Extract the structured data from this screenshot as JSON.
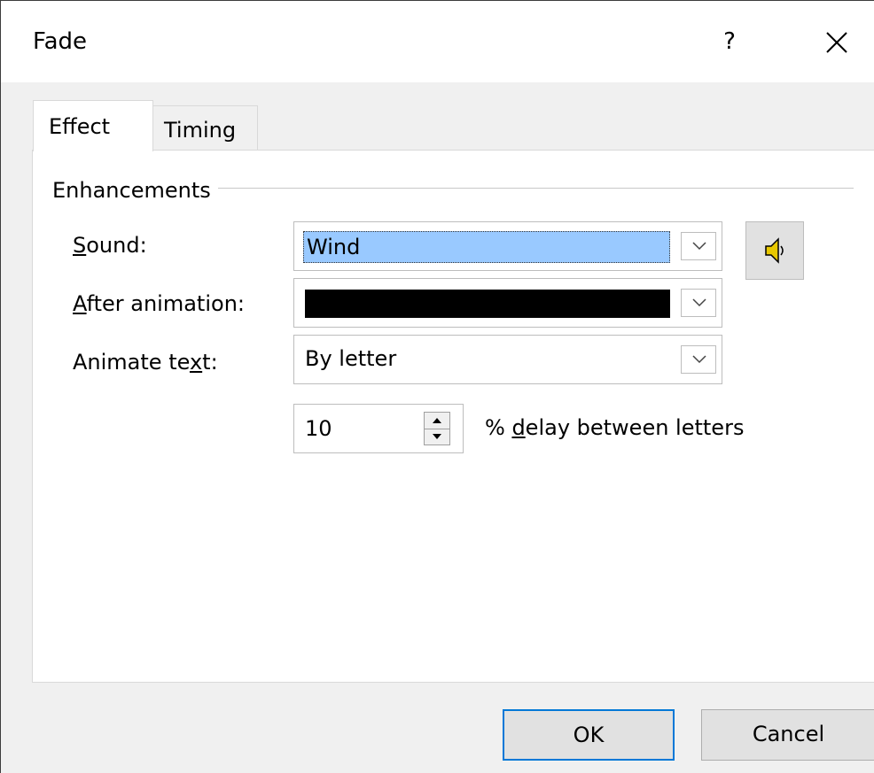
{
  "window": {
    "title": "Fade",
    "help_label": "?"
  },
  "tabs": [
    {
      "label": "Effect",
      "selected": true
    },
    {
      "label": "Timing",
      "selected": false
    }
  ],
  "enhancements": {
    "group_label": "Enhancements",
    "sound": {
      "label_prefix": "",
      "label_accel": "S",
      "label_rest": "ound:",
      "value": "Wind"
    },
    "after_animation": {
      "label_accel": "A",
      "label_rest": "fter animation:",
      "color": "#000000"
    },
    "animate_text": {
      "label_before": "Animate te",
      "label_accel": "x",
      "label_after": "t:",
      "value": "By letter"
    },
    "delay": {
      "value": "10",
      "label_before": "% ",
      "label_accel": "d",
      "label_after": "elay between letters"
    }
  },
  "buttons": {
    "ok_label": "OK",
    "cancel_label": "Cancel"
  },
  "colors": {
    "selection": "#99c9ff",
    "accent": "#0078d7",
    "speaker": "#e8c800"
  }
}
